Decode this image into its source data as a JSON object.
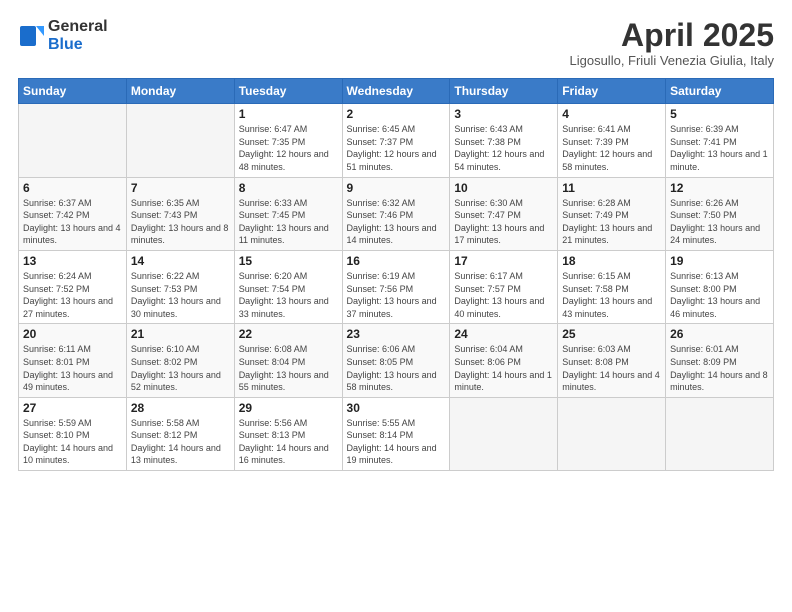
{
  "header": {
    "logo_line1": "General",
    "logo_line2": "Blue",
    "title": "April 2025",
    "subtitle": "Ligosullo, Friuli Venezia Giulia, Italy"
  },
  "days_of_week": [
    "Sunday",
    "Monday",
    "Tuesday",
    "Wednesday",
    "Thursday",
    "Friday",
    "Saturday"
  ],
  "weeks": [
    [
      {
        "day": "",
        "info": ""
      },
      {
        "day": "",
        "info": ""
      },
      {
        "day": "1",
        "info": "Sunrise: 6:47 AM\nSunset: 7:35 PM\nDaylight: 12 hours and 48 minutes."
      },
      {
        "day": "2",
        "info": "Sunrise: 6:45 AM\nSunset: 7:37 PM\nDaylight: 12 hours and 51 minutes."
      },
      {
        "day": "3",
        "info": "Sunrise: 6:43 AM\nSunset: 7:38 PM\nDaylight: 12 hours and 54 minutes."
      },
      {
        "day": "4",
        "info": "Sunrise: 6:41 AM\nSunset: 7:39 PM\nDaylight: 12 hours and 58 minutes."
      },
      {
        "day": "5",
        "info": "Sunrise: 6:39 AM\nSunset: 7:41 PM\nDaylight: 13 hours and 1 minute."
      }
    ],
    [
      {
        "day": "6",
        "info": "Sunrise: 6:37 AM\nSunset: 7:42 PM\nDaylight: 13 hours and 4 minutes."
      },
      {
        "day": "7",
        "info": "Sunrise: 6:35 AM\nSunset: 7:43 PM\nDaylight: 13 hours and 8 minutes."
      },
      {
        "day": "8",
        "info": "Sunrise: 6:33 AM\nSunset: 7:45 PM\nDaylight: 13 hours and 11 minutes."
      },
      {
        "day": "9",
        "info": "Sunrise: 6:32 AM\nSunset: 7:46 PM\nDaylight: 13 hours and 14 minutes."
      },
      {
        "day": "10",
        "info": "Sunrise: 6:30 AM\nSunset: 7:47 PM\nDaylight: 13 hours and 17 minutes."
      },
      {
        "day": "11",
        "info": "Sunrise: 6:28 AM\nSunset: 7:49 PM\nDaylight: 13 hours and 21 minutes."
      },
      {
        "day": "12",
        "info": "Sunrise: 6:26 AM\nSunset: 7:50 PM\nDaylight: 13 hours and 24 minutes."
      }
    ],
    [
      {
        "day": "13",
        "info": "Sunrise: 6:24 AM\nSunset: 7:52 PM\nDaylight: 13 hours and 27 minutes."
      },
      {
        "day": "14",
        "info": "Sunrise: 6:22 AM\nSunset: 7:53 PM\nDaylight: 13 hours and 30 minutes."
      },
      {
        "day": "15",
        "info": "Sunrise: 6:20 AM\nSunset: 7:54 PM\nDaylight: 13 hours and 33 minutes."
      },
      {
        "day": "16",
        "info": "Sunrise: 6:19 AM\nSunset: 7:56 PM\nDaylight: 13 hours and 37 minutes."
      },
      {
        "day": "17",
        "info": "Sunrise: 6:17 AM\nSunset: 7:57 PM\nDaylight: 13 hours and 40 minutes."
      },
      {
        "day": "18",
        "info": "Sunrise: 6:15 AM\nSunset: 7:58 PM\nDaylight: 13 hours and 43 minutes."
      },
      {
        "day": "19",
        "info": "Sunrise: 6:13 AM\nSunset: 8:00 PM\nDaylight: 13 hours and 46 minutes."
      }
    ],
    [
      {
        "day": "20",
        "info": "Sunrise: 6:11 AM\nSunset: 8:01 PM\nDaylight: 13 hours and 49 minutes."
      },
      {
        "day": "21",
        "info": "Sunrise: 6:10 AM\nSunset: 8:02 PM\nDaylight: 13 hours and 52 minutes."
      },
      {
        "day": "22",
        "info": "Sunrise: 6:08 AM\nSunset: 8:04 PM\nDaylight: 13 hours and 55 minutes."
      },
      {
        "day": "23",
        "info": "Sunrise: 6:06 AM\nSunset: 8:05 PM\nDaylight: 13 hours and 58 minutes."
      },
      {
        "day": "24",
        "info": "Sunrise: 6:04 AM\nSunset: 8:06 PM\nDaylight: 14 hours and 1 minute."
      },
      {
        "day": "25",
        "info": "Sunrise: 6:03 AM\nSunset: 8:08 PM\nDaylight: 14 hours and 4 minutes."
      },
      {
        "day": "26",
        "info": "Sunrise: 6:01 AM\nSunset: 8:09 PM\nDaylight: 14 hours and 8 minutes."
      }
    ],
    [
      {
        "day": "27",
        "info": "Sunrise: 5:59 AM\nSunset: 8:10 PM\nDaylight: 14 hours and 10 minutes."
      },
      {
        "day": "28",
        "info": "Sunrise: 5:58 AM\nSunset: 8:12 PM\nDaylight: 14 hours and 13 minutes."
      },
      {
        "day": "29",
        "info": "Sunrise: 5:56 AM\nSunset: 8:13 PM\nDaylight: 14 hours and 16 minutes."
      },
      {
        "day": "30",
        "info": "Sunrise: 5:55 AM\nSunset: 8:14 PM\nDaylight: 14 hours and 19 minutes."
      },
      {
        "day": "",
        "info": ""
      },
      {
        "day": "",
        "info": ""
      },
      {
        "day": "",
        "info": ""
      }
    ]
  ]
}
